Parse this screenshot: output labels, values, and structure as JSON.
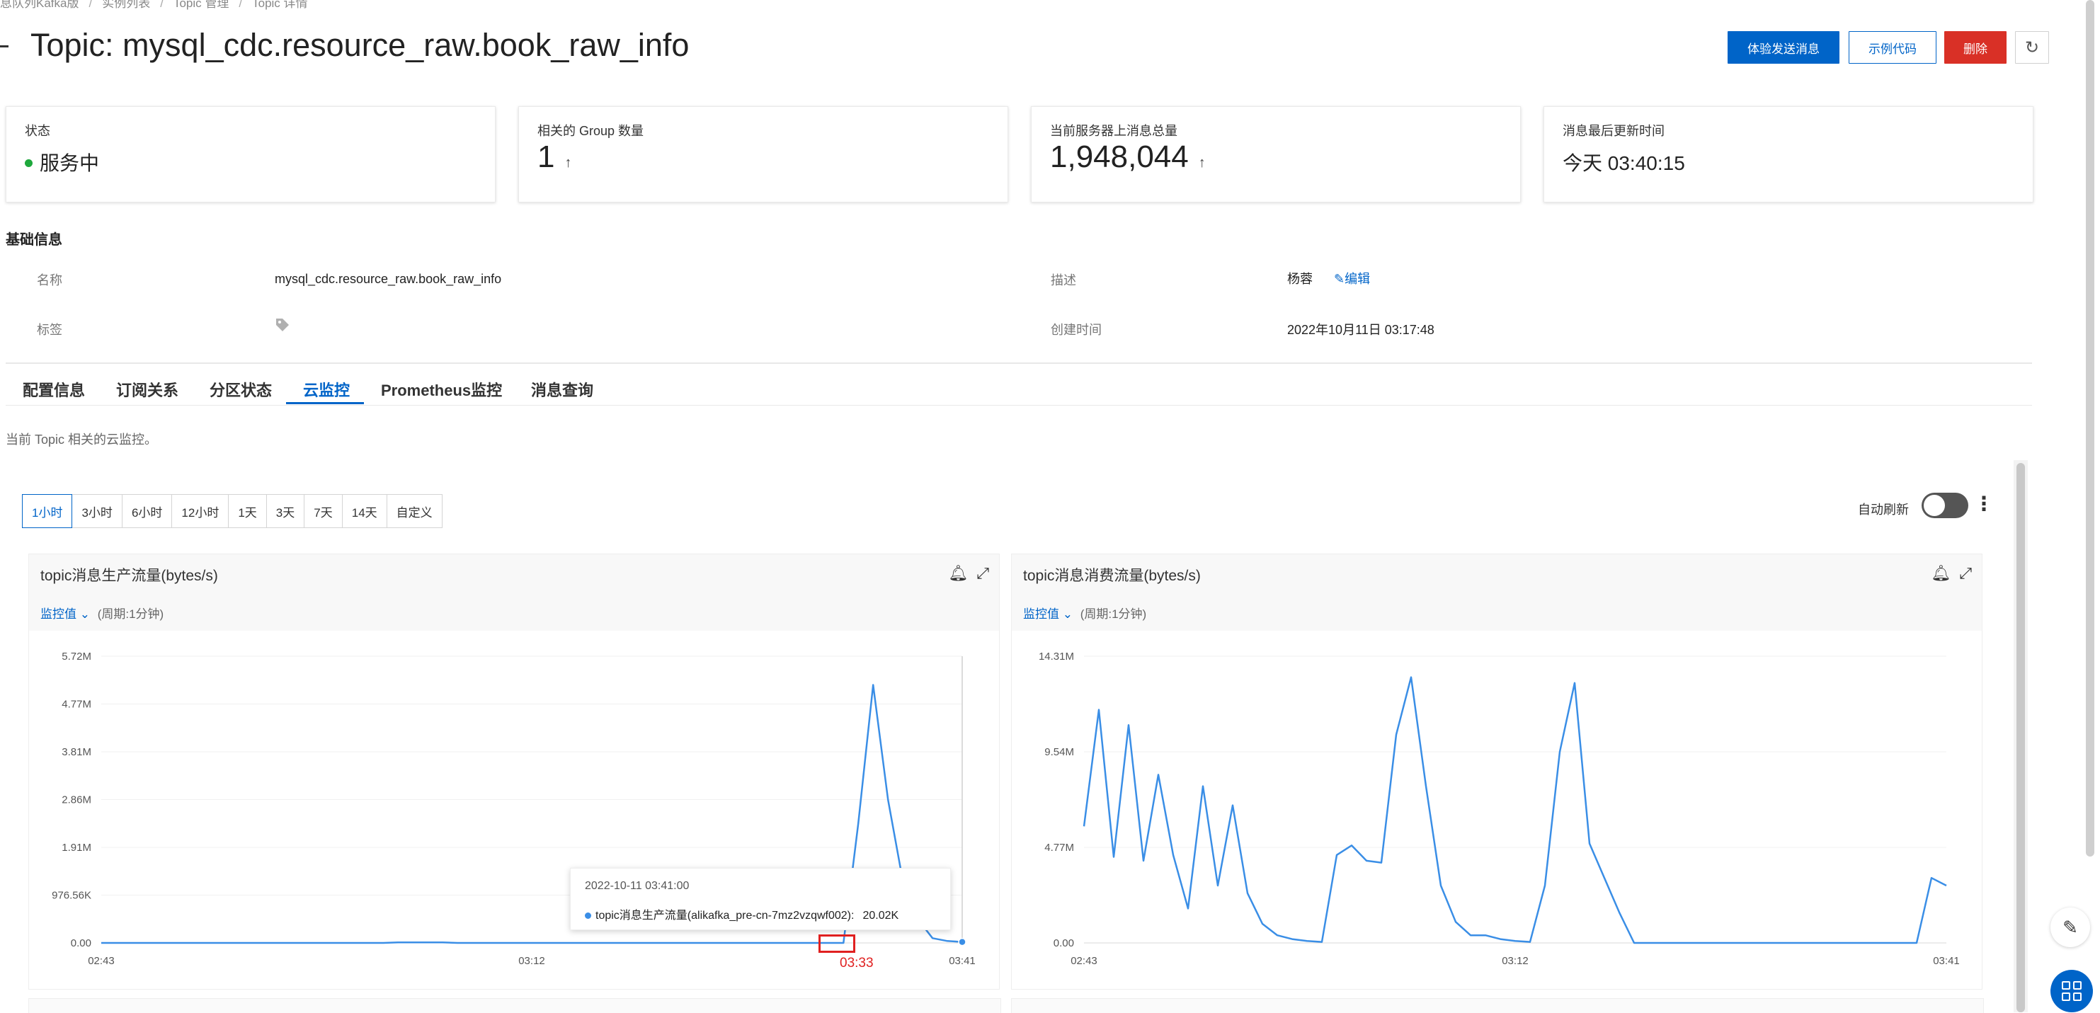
{
  "breadcrumb": [
    "息队列Kafka版",
    "实例列表",
    "Topic 管理",
    "Topic 详情"
  ],
  "header": {
    "title": "Topic: mysql_cdc.resource_raw.book_raw_info",
    "buttons": {
      "send": "体验发送消息",
      "sample": "示例代码",
      "delete": "删除"
    }
  },
  "stats": {
    "status": {
      "label": "状态",
      "value": "服务中"
    },
    "groups": {
      "label": "相关的 Group 数量",
      "value": "1"
    },
    "messages": {
      "label": "当前服务器上消息总量",
      "value": "1,948,044"
    },
    "updated": {
      "label": "消息最后更新时间",
      "value": "今天 03:40:15"
    }
  },
  "basic_info": {
    "title": "基础信息",
    "name_label": "名称",
    "name_value": "mysql_cdc.resource_raw.book_raw_info",
    "desc_label": "描述",
    "desc_value": "杨蓉",
    "edit_label": "编辑",
    "tags_label": "标签",
    "created_label": "创建时间",
    "created_value": "2022年10月11日 03:17:48"
  },
  "tabs": [
    "配置信息",
    "订阅关系",
    "分区状态",
    "云监控",
    "Prometheus监控",
    "消息查询"
  ],
  "active_tab": "云监控",
  "monitor_desc": "当前 Topic 相关的云监控。",
  "time_ranges": [
    "1小时",
    "3小时",
    "6小时",
    "12小时",
    "1天",
    "3天",
    "7天",
    "14天",
    "自定义"
  ],
  "auto_refresh_label": "自动刷新",
  "charts": [
    {
      "title": "topic消息生产流量(bytes/s)",
      "metric_label": "监控值",
      "period_label": "(周期:1分钟)"
    },
    {
      "title": "topic消息消费流量(bytes/s)",
      "metric_label": "监控值",
      "period_label": "(周期:1分钟)"
    }
  ],
  "tooltip": {
    "time": "2022-10-11 03:41:00",
    "series": "topic消息生产流量(alikafka_pre-cn-7mz2vzqwf002):",
    "value": "20.02K"
  },
  "highlight_label": "03:33",
  "colors": {
    "accent": "#0064c8",
    "danger": "#d93026",
    "series": "#3a8ee6",
    "status_ok": "#1ea83c",
    "highlight": "#e02020"
  },
  "icons": [
    "refresh-icon",
    "tag-icon",
    "edit-icon",
    "bell-icon",
    "expand-icon",
    "chevron-down-icon",
    "more-icon",
    "pencil-icon",
    "grid-icon"
  ],
  "chart_data": [
    {
      "type": "line",
      "title": "topic消息生产流量(bytes/s)",
      "x_ticks": [
        "02:43",
        "03:12",
        "03:41"
      ],
      "y_ticks": [
        "0.00",
        "976.56K",
        "1.91M",
        "2.86M",
        "3.81M",
        "4.77M",
        "5.72M"
      ],
      "ylim": [
        0,
        6000000
      ],
      "x": [
        "02:43",
        "02:44",
        "02:45",
        "02:46",
        "02:47",
        "02:48",
        "02:49",
        "02:50",
        "02:51",
        "02:52",
        "02:53",
        "02:54",
        "02:55",
        "02:56",
        "02:57",
        "02:58",
        "02:59",
        "03:00",
        "03:01",
        "03:02",
        "03:03",
        "03:04",
        "03:05",
        "03:06",
        "03:07",
        "03:08",
        "03:09",
        "03:10",
        "03:11",
        "03:12",
        "03:13",
        "03:14",
        "03:15",
        "03:16",
        "03:17",
        "03:18",
        "03:19",
        "03:20",
        "03:21",
        "03:22",
        "03:23",
        "03:24",
        "03:25",
        "03:26",
        "03:27",
        "03:28",
        "03:29",
        "03:30",
        "03:31",
        "03:32",
        "03:33",
        "03:34",
        "03:35",
        "03:36",
        "03:37",
        "03:38",
        "03:39",
        "03:40",
        "03:41"
      ],
      "series": [
        {
          "values": [
            0,
            0,
            0,
            0,
            0,
            0,
            0,
            0,
            0,
            0,
            0,
            0,
            0,
            0,
            0,
            0,
            0,
            0,
            0,
            0,
            10000,
            10000,
            10000,
            10000,
            0,
            0,
            0,
            0,
            0,
            0,
            0,
            0,
            0,
            0,
            0,
            0,
            0,
            0,
            0,
            0,
            0,
            0,
            0,
            0,
            0,
            0,
            0,
            0,
            0,
            0,
            0,
            2500000,
            5400000,
            3000000,
            1300000,
            500000,
            100000,
            40000,
            20020
          ]
        }
      ]
    },
    {
      "type": "line",
      "title": "topic消息消费流量(bytes/s)",
      "x_ticks": [
        "02:43",
        "03:12",
        "03:41"
      ],
      "y_ticks": [
        "0.00",
        "4.77M",
        "9.54M",
        "14.31M"
      ],
      "ylim": [
        0,
        15000000
      ],
      "x": [
        "02:43",
        "02:44",
        "02:45",
        "02:46",
        "02:47",
        "02:48",
        "02:49",
        "02:50",
        "02:51",
        "02:52",
        "02:53",
        "02:54",
        "02:55",
        "02:56",
        "02:57",
        "02:58",
        "02:59",
        "03:00",
        "03:01",
        "03:02",
        "03:03",
        "03:04",
        "03:05",
        "03:06",
        "03:07",
        "03:08",
        "03:09",
        "03:10",
        "03:11",
        "03:12",
        "03:13",
        "03:14",
        "03:15",
        "03:16",
        "03:17",
        "03:18",
        "03:19",
        "03:20",
        "03:21",
        "03:22",
        "03:23",
        "03:24",
        "03:25",
        "03:26",
        "03:27",
        "03:28",
        "03:29",
        "03:30",
        "03:31",
        "03:32",
        "03:33",
        "03:34",
        "03:35",
        "03:36",
        "03:37",
        "03:38",
        "03:39",
        "03:40",
        "03:41"
      ],
      "series": [
        {
          "values": [
            6100000,
            12200000,
            4500000,
            11400000,
            4300000,
            8800000,
            4600000,
            1800000,
            8200000,
            3000000,
            7200000,
            2600000,
            1000000,
            400000,
            200000,
            100000,
            50000,
            4600000,
            5100000,
            4300000,
            4200000,
            10900000,
            13900000,
            8200000,
            3000000,
            1100000,
            400000,
            400000,
            200000,
            100000,
            50000,
            3000000,
            10000000,
            13600000,
            5200000,
            3400000,
            1600000,
            0,
            0,
            0,
            0,
            0,
            0,
            0,
            0,
            0,
            0,
            0,
            0,
            0,
            0,
            0,
            0,
            0,
            0,
            0,
            0,
            3400000,
            3000000
          ]
        }
      ]
    }
  ]
}
